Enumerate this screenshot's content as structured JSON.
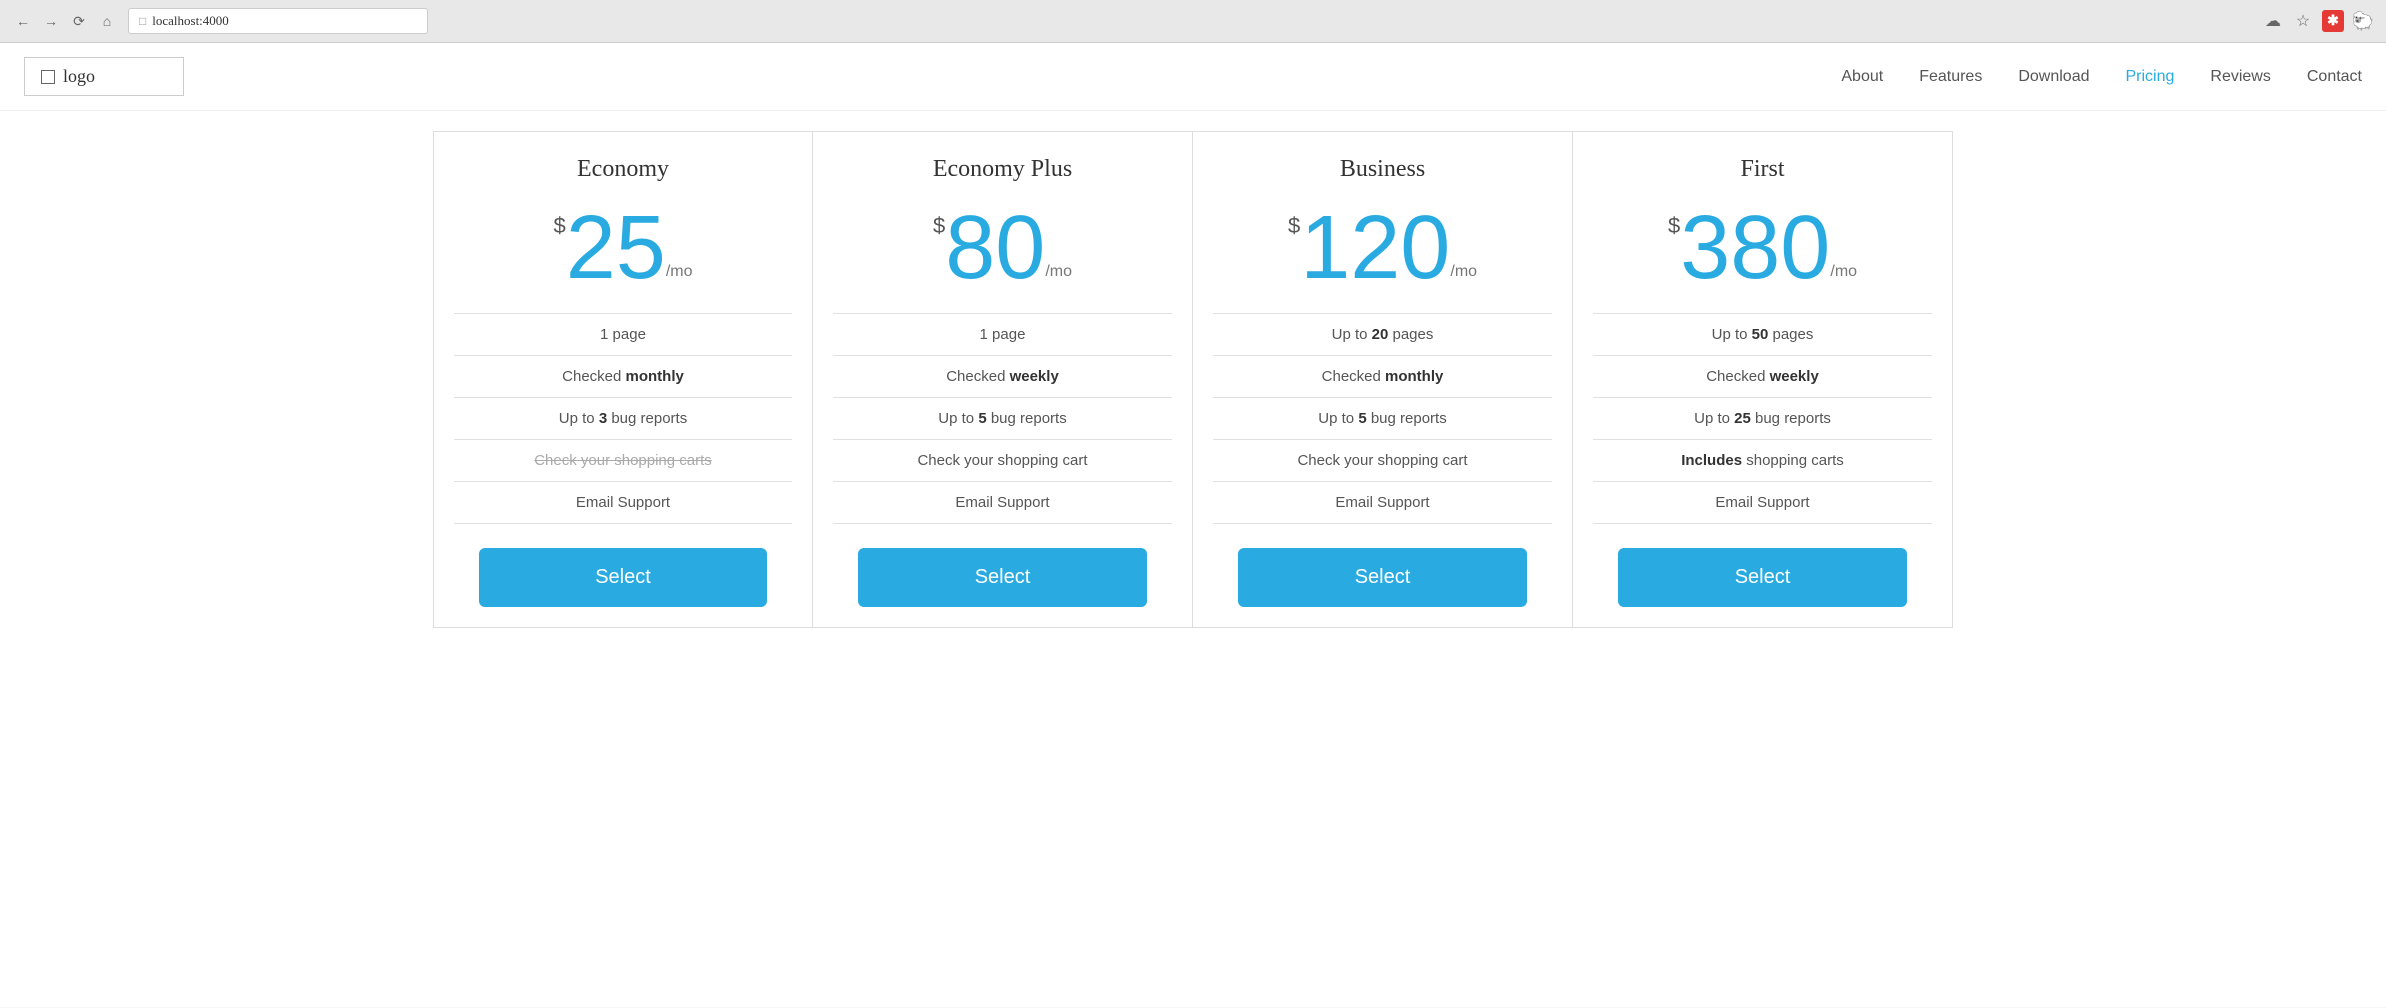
{
  "browser": {
    "url": "localhost:4000",
    "back_title": "back",
    "forward_title": "forward",
    "refresh_title": "refresh",
    "home_title": "home"
  },
  "nav": {
    "logo_text": "logo",
    "links": [
      {
        "id": "about",
        "label": "About",
        "active": false
      },
      {
        "id": "features",
        "label": "Features",
        "active": false
      },
      {
        "id": "download",
        "label": "Download",
        "active": false
      },
      {
        "id": "pricing",
        "label": "Pricing",
        "active": true
      },
      {
        "id": "reviews",
        "label": "Reviews",
        "active": false
      },
      {
        "id": "contact",
        "label": "Contact",
        "active": false
      }
    ]
  },
  "plans": [
    {
      "id": "economy",
      "name": "Economy",
      "price": "25",
      "period": "/mo",
      "features": [
        {
          "text": "1 page",
          "bold_part": "",
          "strikethrough": false
        },
        {
          "text": "Checked ",
          "bold_part": "monthly",
          "strikethrough": false
        },
        {
          "text": "Up to ",
          "bold_part": "3",
          "suffix": " bug reports",
          "strikethrough": false
        },
        {
          "text": "Check your shopping carts",
          "bold_part": "",
          "strikethrough": true
        },
        {
          "text": "Email Support",
          "bold_part": "",
          "strikethrough": false
        }
      ],
      "button_label": "Select"
    },
    {
      "id": "economy-plus",
      "name": "Economy Plus",
      "price": "80",
      "period": "/mo",
      "features": [
        {
          "text": "1 page",
          "bold_part": "",
          "strikethrough": false
        },
        {
          "text": "Checked ",
          "bold_part": "weekly",
          "strikethrough": false
        },
        {
          "text": "Up to ",
          "bold_part": "5",
          "suffix": " bug reports",
          "strikethrough": false
        },
        {
          "text": "Check your shopping cart",
          "bold_part": "",
          "strikethrough": false
        },
        {
          "text": "Email Support",
          "bold_part": "",
          "strikethrough": false
        }
      ],
      "button_label": "Select"
    },
    {
      "id": "business",
      "name": "Business",
      "price": "120",
      "period": "/mo",
      "features": [
        {
          "text": "Up to ",
          "bold_part": "20",
          "suffix": " pages",
          "strikethrough": false
        },
        {
          "text": "Checked ",
          "bold_part": "monthly",
          "strikethrough": false
        },
        {
          "text": "Up to ",
          "bold_part": "5",
          "suffix": " bug reports",
          "strikethrough": false
        },
        {
          "text": "Check your shopping cart",
          "bold_part": "",
          "strikethrough": false
        },
        {
          "text": "Email Support",
          "bold_part": "",
          "strikethrough": false
        }
      ],
      "button_label": "Select"
    },
    {
      "id": "first",
      "name": "First",
      "price": "380",
      "period": "/mo",
      "features": [
        {
          "text": "Up to ",
          "bold_part": "50",
          "suffix": " pages",
          "strikethrough": false
        },
        {
          "text": "Checked ",
          "bold_part": "weekly",
          "strikethrough": false
        },
        {
          "text": "Up to ",
          "bold_part": "25",
          "suffix": " bug reports",
          "strikethrough": false
        },
        {
          "text": "",
          "bold_part": "Includes",
          "suffix": " shopping carts",
          "strikethrough": false
        },
        {
          "text": "Email Support",
          "bold_part": "",
          "strikethrough": false
        }
      ],
      "button_label": "Select"
    }
  ],
  "colors": {
    "accent": "#29abe2",
    "text_dark": "#333333",
    "text_mid": "#555555",
    "border": "#dddddd"
  }
}
